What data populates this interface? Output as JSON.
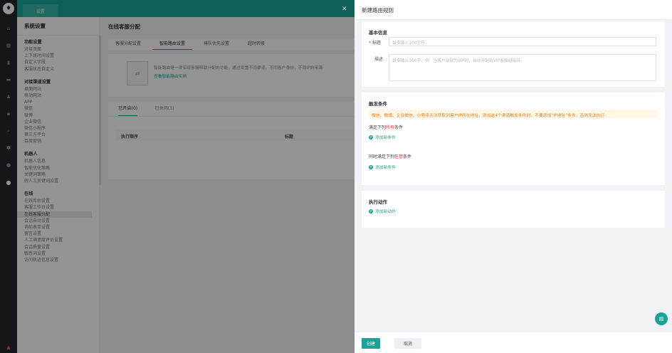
{
  "topbar": {
    "tab_label": "设置"
  },
  "sidebar": {
    "title": "系统设置",
    "groups": [
      {
        "header": "功能设置",
        "items": [
          "对接页面",
          "上下班时间设置",
          "自定义字段",
          "客服状态自定义"
        ]
      },
      {
        "header": "对接渠道设置",
        "items": [
          "桌面网站",
          "移动网站",
          "APP",
          "微信",
          "微博",
          "企业微信",
          "微信小程序",
          "第三方平台",
          "百度营销"
        ]
      },
      {
        "header": "机器人",
        "items": [
          "机器人信息",
          "智能优化策略",
          "关键词策略",
          "转人工关键词设置"
        ]
      },
      {
        "header": "在线",
        "items": [
          "在线库助设置",
          "客服工作台设置",
          "在线客服分配",
          "会话自动设置",
          "询前表单设置",
          "留言设置",
          "人工满意度评价设置",
          "会话质量设置",
          "敏感词设置",
          "访问轨迹信息设置"
        ]
      }
    ],
    "active_item": "在线客服分配"
  },
  "main": {
    "page_title": "在线客服分配",
    "tabs": [
      "客服分配设置",
      "智能路由设置",
      "排队优先设置",
      "超时转接"
    ],
    "active_tab": "智能路由设置",
    "intro_text": "智能路由是一项实现客服帮助分配的功能，通过设置不同渠道，不同客户身份，不同IP的来源",
    "intro_link": "查看智能路由实例",
    "subtabs": [
      "已开启(0)",
      "已关闭(3)"
    ],
    "columns": [
      "执行顺序",
      "标题"
    ]
  },
  "drawer": {
    "title": "新建路由规则",
    "basic": {
      "header": "基本信息",
      "title_label": "标题",
      "title_placeholder": "最多输入100字符",
      "desc_label": "描述",
      "desc_placeholder": "最多输入100字，例：当客户级别为VIP时，自动分配给VIP客服组接待。"
    },
    "trigger": {
      "header": "触发条件",
      "warning": "微信、微博、企业微信、小程序无法获取到客户IP所在地址，添加这4个渠道触发条件时，不要添加“IP地址”条件，否则无法执行",
      "all_prefix": "满足下列",
      "all_highlight": "所有",
      "all_suffix": "条件",
      "add_cond": "添加新条件",
      "any_prefix": "同时满足下列",
      "any_highlight": "任意",
      "any_suffix": "条件",
      "add_cond2": "添加新条件"
    },
    "action": {
      "header": "执行动作",
      "add_action": "添加新动作"
    },
    "footer": {
      "create": "创建",
      "cancel": "取消"
    }
  },
  "colors": {
    "accent": "#19a495",
    "warning_bg": "#fff7e6",
    "warning_text": "#d9822b",
    "required": "#e33333"
  },
  "icons": [
    "tooth-logo-icon",
    "home-icon",
    "grid-icon",
    "chart-icon",
    "chat-icon",
    "user-icon",
    "stats-icon",
    "search-icon",
    "settings-icon",
    "help-icon",
    "info-icon",
    "alert-icon",
    "close-icon",
    "plus-icon",
    "chat-bubble-icon"
  ]
}
